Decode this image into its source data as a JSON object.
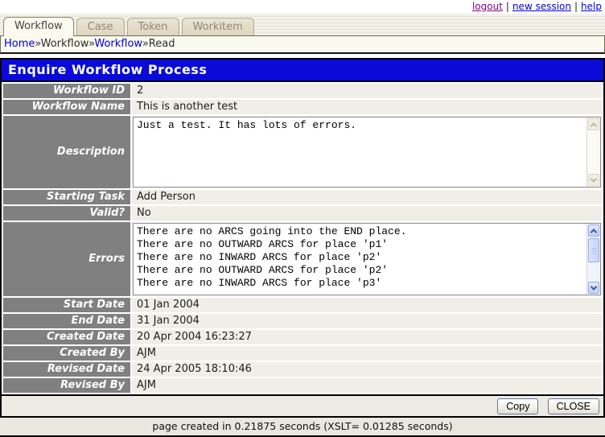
{
  "top_links": {
    "logout": "logout",
    "new_session": "new session",
    "help": "help",
    "separator": "|"
  },
  "tabs": [
    {
      "label": "Workflow",
      "active": true
    },
    {
      "label": "Case",
      "active": false
    },
    {
      "label": "Token",
      "active": false
    },
    {
      "label": "Workitem",
      "active": false
    }
  ],
  "breadcrumb": {
    "separator": "»",
    "segments": [
      {
        "text": "Home",
        "link": true
      },
      {
        "text": "Workflow",
        "link": false
      },
      {
        "text": "Workflow",
        "link": true
      },
      {
        "text": "Read",
        "link": false
      }
    ]
  },
  "title": "Enquire Workflow Process",
  "form": {
    "rows": [
      {
        "key": "workflow-id",
        "label": "Workflow ID",
        "type": "text",
        "value": "2"
      },
      {
        "key": "workflow-name",
        "label": "Workflow Name",
        "type": "text",
        "value": "This is another test"
      },
      {
        "key": "description",
        "label": "Description",
        "type": "textarea",
        "height": 88,
        "scroll": "disabled",
        "lines": [
          "Just a test. It has lots of errors."
        ]
      },
      {
        "key": "starting-task",
        "label": "Starting Task",
        "type": "text",
        "value": "Add Person"
      },
      {
        "key": "valid",
        "label": "Valid?",
        "type": "text",
        "value": "No"
      },
      {
        "key": "errors",
        "label": "Errors",
        "type": "textarea",
        "height": 90,
        "scroll": "enabled",
        "lines": [
          "There are no ARCS going into the END place.",
          "There are no OUTWARD ARCS for place 'p1'",
          "There are no INWARD ARCS for place 'p2'",
          "There are no OUTWARD ARCS for place 'p2'",
          "There are no INWARD ARCS for place 'p3'"
        ]
      },
      {
        "key": "start-date",
        "label": "Start Date",
        "type": "text",
        "value": "01 Jan 2004"
      },
      {
        "key": "end-date",
        "label": "End Date",
        "type": "text",
        "value": "31 Jan 2004"
      },
      {
        "key": "created-date",
        "label": "Created Date",
        "type": "text",
        "value": "20 Apr 2004 16:23:27"
      },
      {
        "key": "created-by",
        "label": "Created By",
        "type": "text",
        "value": "AJM"
      },
      {
        "key": "revised-date",
        "label": "Revised Date",
        "type": "text",
        "value": "24 Apr 2005 18:10:46"
      },
      {
        "key": "revised-by",
        "label": "Revised By",
        "type": "text",
        "value": "AJM"
      }
    ]
  },
  "buttons": {
    "copy": "Copy",
    "close": "CLOSE"
  },
  "footer": {
    "text": "page created in 0.21875 seconds (XSLT= 0.01285 seconds)"
  },
  "colors": {
    "title_bg": "#0a0ad8",
    "label_bg": "#808080",
    "value_bg": "#f0eee6",
    "link_blue": "#0000dd",
    "visited_link": "#800080"
  }
}
